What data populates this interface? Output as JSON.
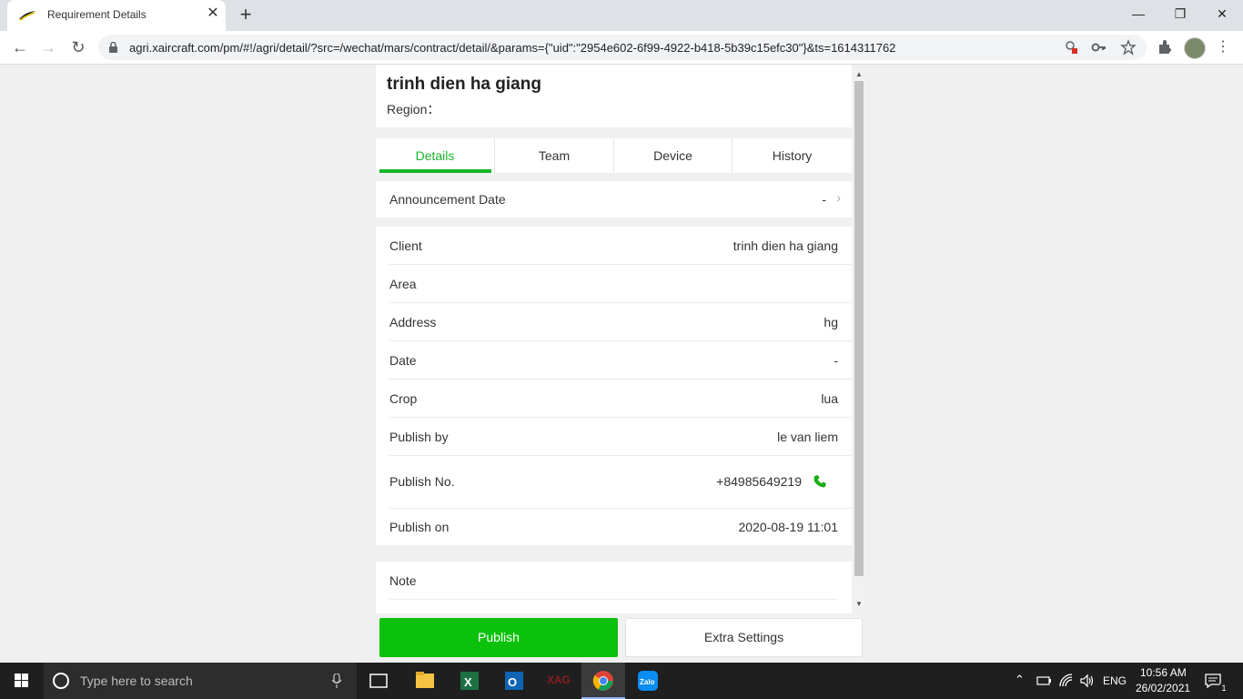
{
  "browser": {
    "tab_title": "Requirement Details",
    "url": "agri.xaircraft.com/pm/#!/agri/detail/?src=/wechat/mars/contract/detail/&params={\"uid\":\"2954e602-6f99-4922-b418-5b39c15efc30\"}&ts=1614311762"
  },
  "page": {
    "title": "trinh dien ha giang",
    "region_label": "Region："
  },
  "tabs": [
    {
      "label": "Details",
      "active": true
    },
    {
      "label": "Team",
      "active": false
    },
    {
      "label": "Device",
      "active": false
    },
    {
      "label": "History",
      "active": false
    }
  ],
  "announcement": {
    "label": "Announcement Date",
    "value": "-"
  },
  "details": [
    {
      "label": "Client",
      "value": "trinh dien ha giang"
    },
    {
      "label": "Area",
      "value": ""
    },
    {
      "label": "Address",
      "value": "hg"
    },
    {
      "label": "Date",
      "value": "-"
    },
    {
      "label": "Crop",
      "value": "lua"
    },
    {
      "label": "Publish by",
      "value": "le van liem"
    },
    {
      "label": "Publish No.",
      "value": "+84985649219"
    },
    {
      "label": "Publish on",
      "value": "2020-08-19 11:01"
    }
  ],
  "note": {
    "label": "Note"
  },
  "buttons": {
    "publish": "Publish",
    "extra_settings": "Extra Settings"
  },
  "taskbar": {
    "search_placeholder": "Type here to search",
    "language": "ENG",
    "time": "10:56 AM",
    "date": "26/02/2021",
    "notification_count": "1"
  },
  "colors": {
    "accent_green": "#18b52a",
    "publish_button": "#0bc10b"
  }
}
